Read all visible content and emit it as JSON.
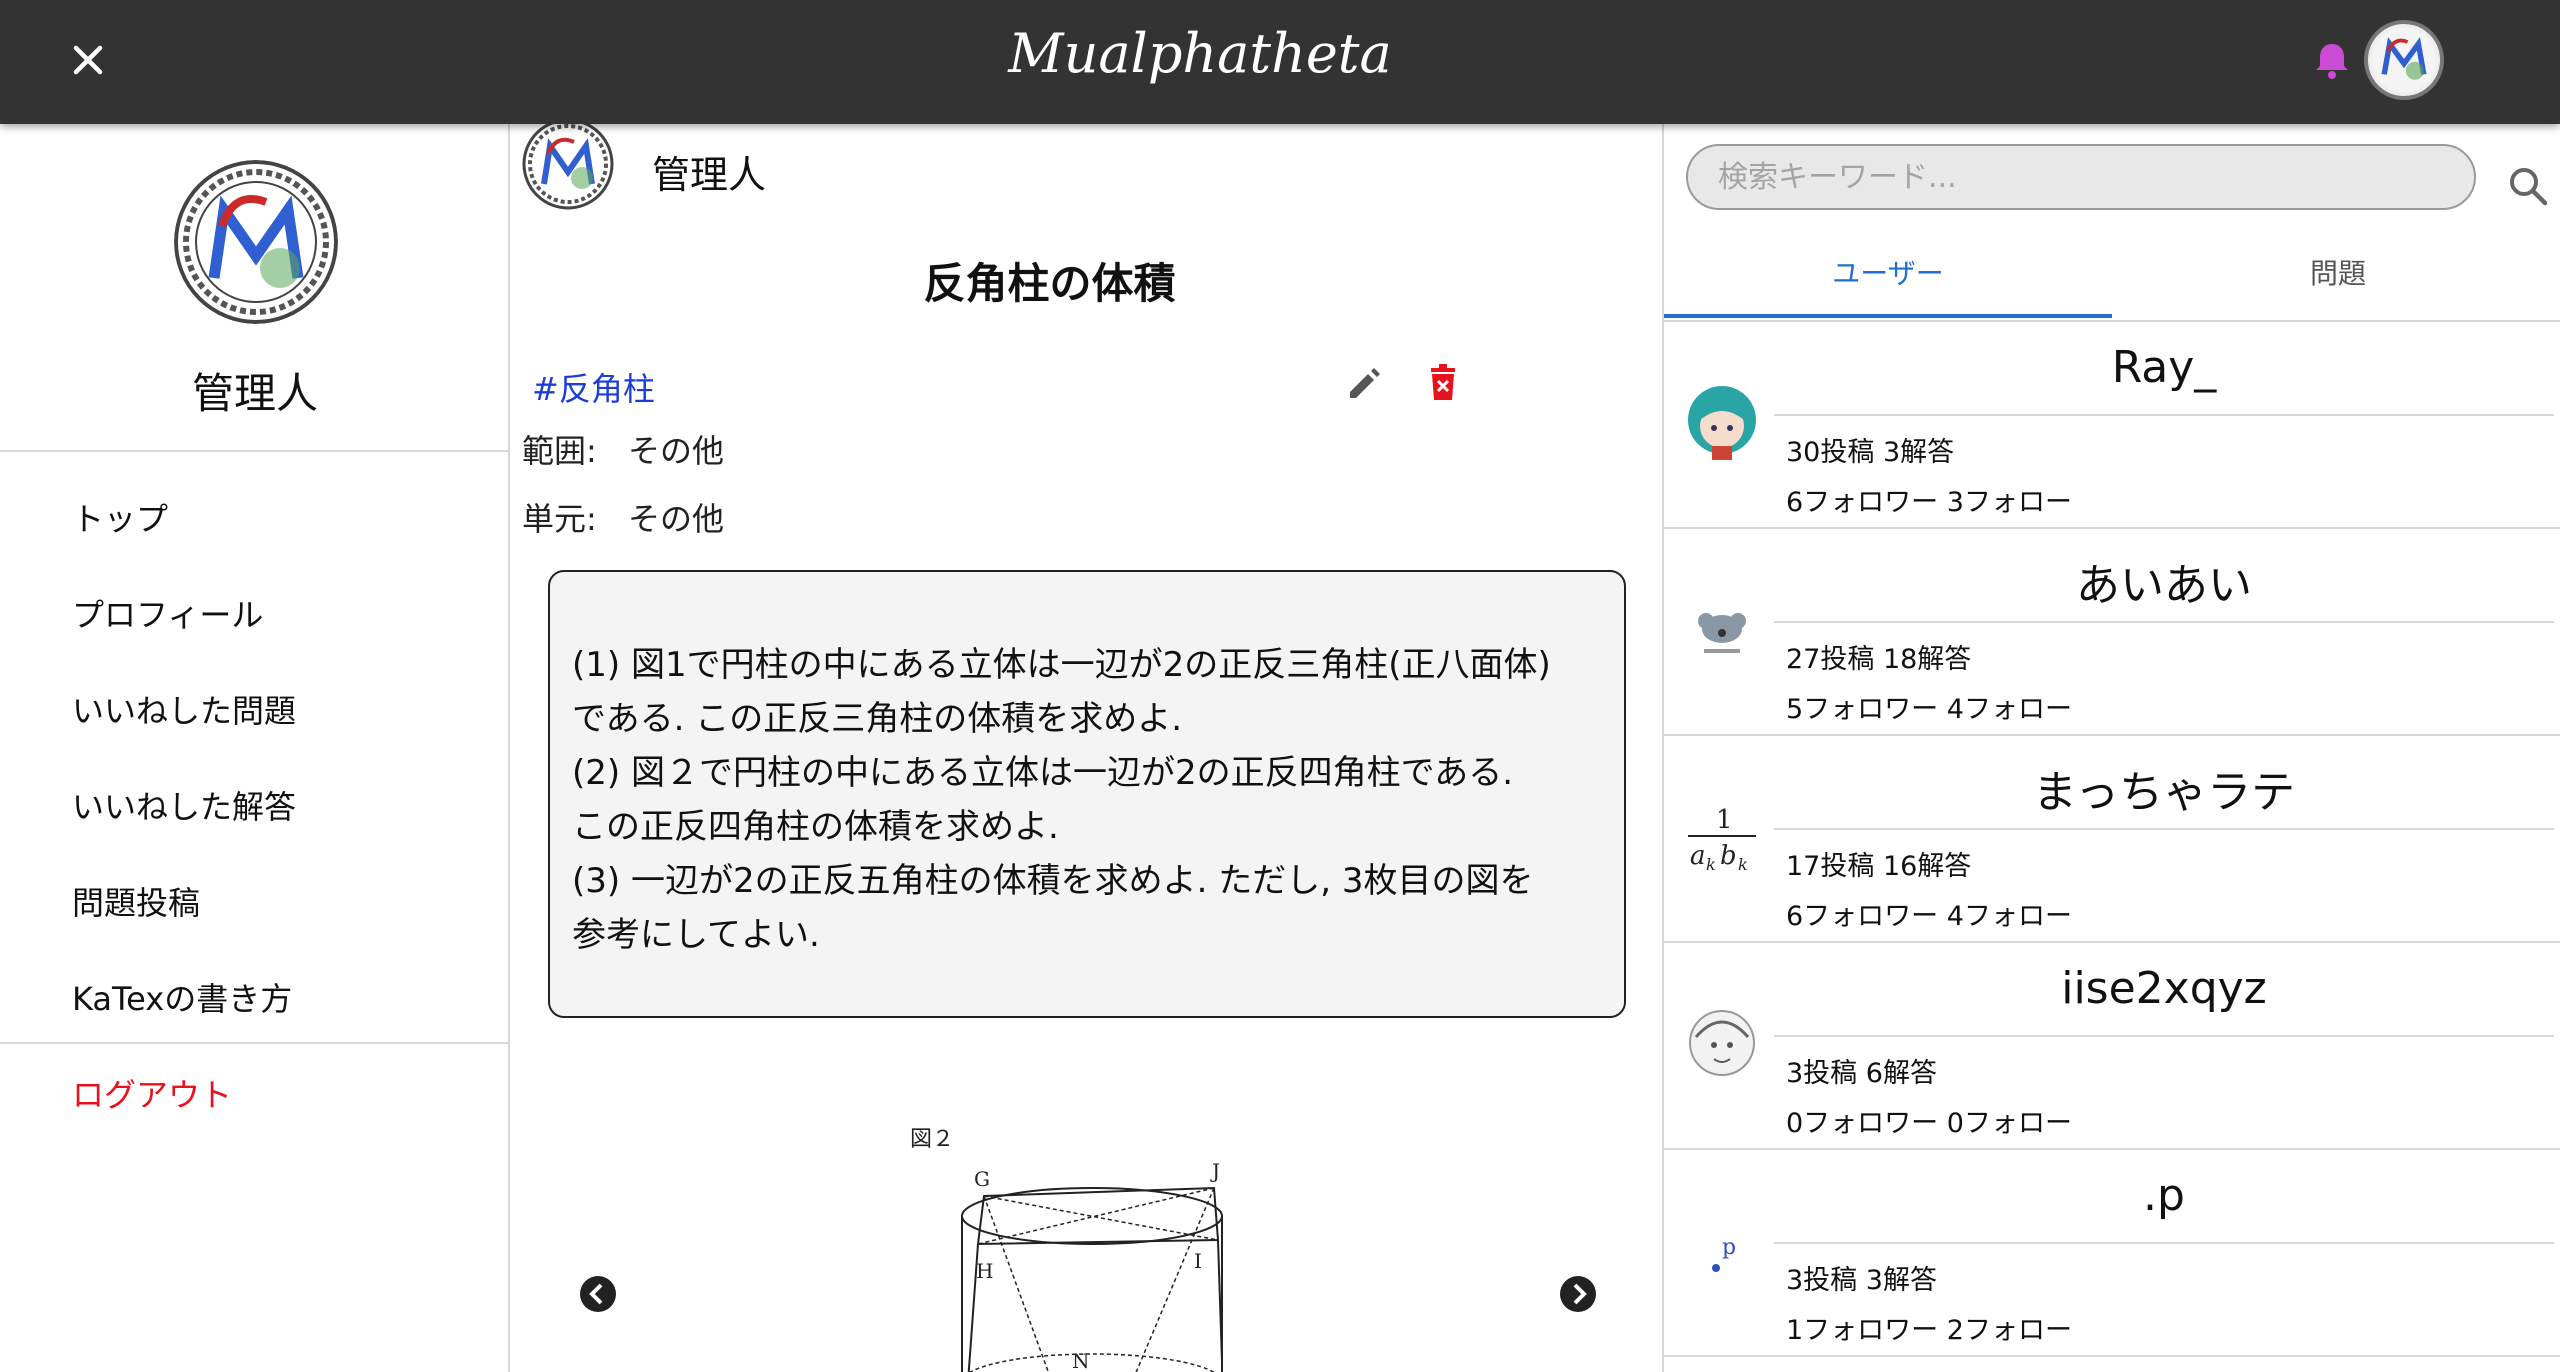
{
  "header": {
    "app_title": "Mualphatheta",
    "brand_color": "#333333",
    "bell_color": "#c94bd6"
  },
  "sidebar": {
    "user_name": "管理人",
    "items": [
      {
        "label": "トップ"
      },
      {
        "label": "プロフィール"
      },
      {
        "label": "いいねした問題"
      },
      {
        "label": "いいねした解答"
      },
      {
        "label": "問題投稿"
      },
      {
        "label": "KaTexの書き方"
      }
    ],
    "logout_label": "ログアウト",
    "logout_color": "#e8121f"
  },
  "post": {
    "author": "管理人",
    "title": "反角柱の体積",
    "tag": "#反角柱",
    "range_key": "範囲:",
    "range_value": "その他",
    "unit_key": "単元:",
    "unit_value": "その他",
    "body_lines": [
      "(1) 図1で円柱の中にある立体は一辺が2の正反三角柱(正八面体)",
      "である. この正反三角柱の体積を求めよ.",
      "(2) 図２で円柱の中にある立体は一辺が2の正反四角柱である.",
      "この正反四角柱の体積を求めよ.",
      "(3) 一辺が2の正反五角柱の体積を求めよ. ただし, 3枚目の図を",
      "参考にしてよい."
    ],
    "figure": {
      "caption": "図２",
      "point_labels": [
        "G",
        "J",
        "H",
        "I",
        "N"
      ]
    }
  },
  "search": {
    "placeholder": "検索キーワード..."
  },
  "tabs": {
    "users": "ユーザー",
    "problems": "問題",
    "active": "users",
    "accent_color": "#1f6fd1"
  },
  "users": [
    {
      "name": "Ray_",
      "stats1": "30投稿 3解答",
      "stats2": "6フォロワー 3フォロー",
      "avatar_icon": "anime-girl-avatar-icon"
    },
    {
      "name": "あいあい",
      "stats1": "27投稿 18解答",
      "stats2": "5フォロワー 4フォロー",
      "avatar_icon": "koala-avatar-icon"
    },
    {
      "name": "まっちゃラテ",
      "stats1": "17投稿 16解答",
      "stats2": "6フォロワー 4フォロー",
      "avatar_icon": "fraction-avatar-icon",
      "avatar_text": {
        "num": "1",
        "den": "a",
        "sub1": "k",
        "den2": "b",
        "sub2": "k"
      }
    },
    {
      "name": "iise2xqyz",
      "stats1": "3投稿 6解答",
      "stats2": "0フォロワー 0フォロー",
      "avatar_icon": "sketch-avatar-icon"
    },
    {
      "name": ".p",
      "stats1": "3投稿 3解答",
      "stats2": "1フォロワー 2フォロー",
      "avatar_icon": "dot-p-avatar-icon",
      "avatar_text": "p"
    }
  ]
}
